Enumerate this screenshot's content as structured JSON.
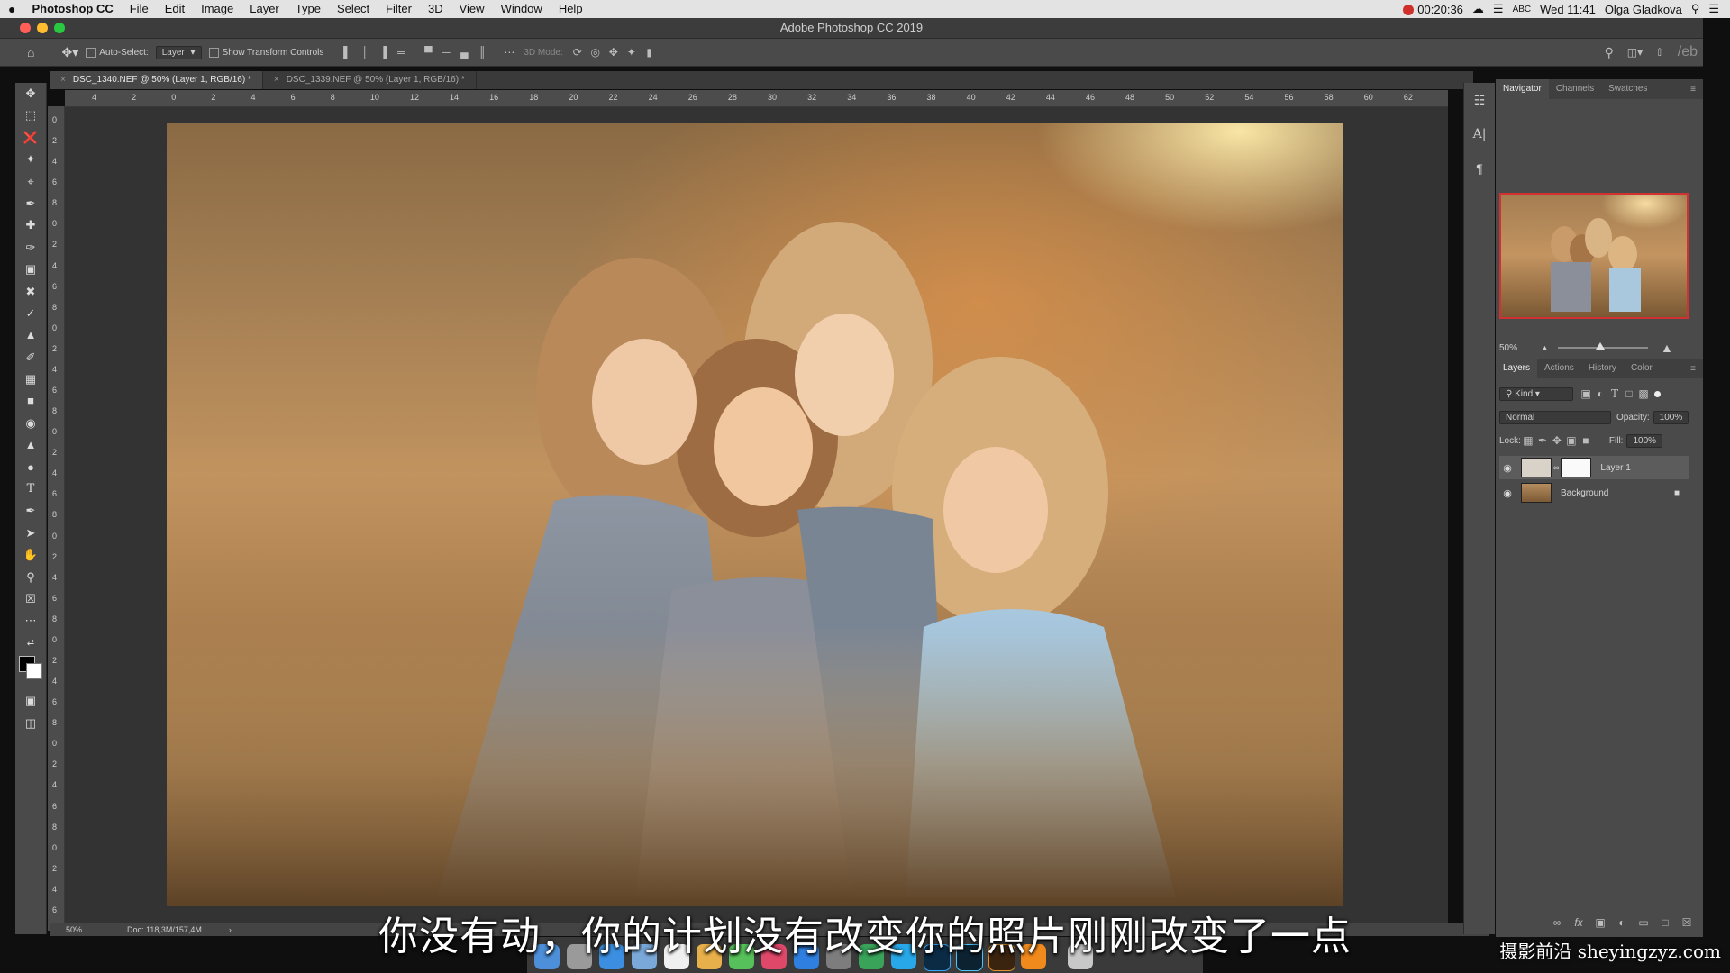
{
  "menubar": {
    "apple_icon": "apple-icon",
    "app_name": "Photoshop CC",
    "menus": [
      "File",
      "Edit",
      "Image",
      "Layer",
      "Type",
      "Select",
      "Filter",
      "3D",
      "View",
      "Window",
      "Help"
    ],
    "recording_time": "00:20:36",
    "keyboard_label": "ABC",
    "clock": "Wed 11:41",
    "user": "Olga Gladkova"
  },
  "window": {
    "title": "Adobe Photoshop CC 2019",
    "traffic_light_colors": [
      "#ff5f57",
      "#febc2e",
      "#28c840"
    ]
  },
  "options_bar": {
    "auto_select_label": "Auto-Select:",
    "auto_select_value": "Layer",
    "show_transform_label": "Show Transform Controls",
    "mode_3d_label": "3D Mode:",
    "edge_text": "/eb"
  },
  "tabs": [
    {
      "label": "DSC_1340.NEF @ 50% (Layer 1, RGB/16) *",
      "active": true
    },
    {
      "label": "DSC_1339.NEF @ 50% (Layer 1, RGB/16) *",
      "active": false
    }
  ],
  "ruler": {
    "h_ticks": [
      "4",
      "2",
      "0",
      "2",
      "4",
      "6",
      "8",
      "10",
      "12",
      "14",
      "16",
      "18",
      "20",
      "22",
      "24",
      "26",
      "28",
      "30",
      "32",
      "34",
      "36",
      "38",
      "40",
      "42",
      "44",
      "46",
      "48",
      "50",
      "52",
      "54",
      "56",
      "58",
      "60",
      "62"
    ],
    "v_ticks": [
      "0",
      "2",
      "4",
      "6",
      "8",
      "0",
      "2",
      "4",
      "6",
      "8",
      "0",
      "2",
      "4",
      "6",
      "8",
      "0",
      "2",
      "4",
      "6",
      "8",
      "0",
      "2",
      "4",
      "6",
      "8",
      "0",
      "2",
      "4",
      "6",
      "8",
      "0",
      "2",
      "4",
      "6",
      "8",
      "0",
      "2",
      "4",
      "6"
    ]
  },
  "status": {
    "zoom": "50%",
    "doc": "Doc: 118,3M/157,4M",
    "arrow": "›"
  },
  "navigator": {
    "tabs": [
      "Navigator",
      "Channels",
      "Swatches"
    ],
    "zoom": "50%"
  },
  "layers_panel": {
    "tabs": [
      "Layers",
      "Actions",
      "History",
      "Color"
    ],
    "filter_label": "Kind",
    "blend_mode": "Normal",
    "opacity_label": "Opacity:",
    "opacity_value": "100%",
    "lock_label": "Lock:",
    "fill_label": "Fill:",
    "fill_value": "100%",
    "layers": [
      {
        "name": "Layer 1",
        "selected": true
      },
      {
        "name": "Background",
        "selected": false
      }
    ]
  },
  "subtitle": "你没有动，你的计划没有改变你的照片刚刚改变了一点",
  "watermark": "摄影前沿 sheyingzyz.com",
  "colors": {
    "menubar": "#e3e3e3",
    "panel": "#4a4a4a",
    "canvas": "#333333",
    "selection_red": "#d03232"
  }
}
